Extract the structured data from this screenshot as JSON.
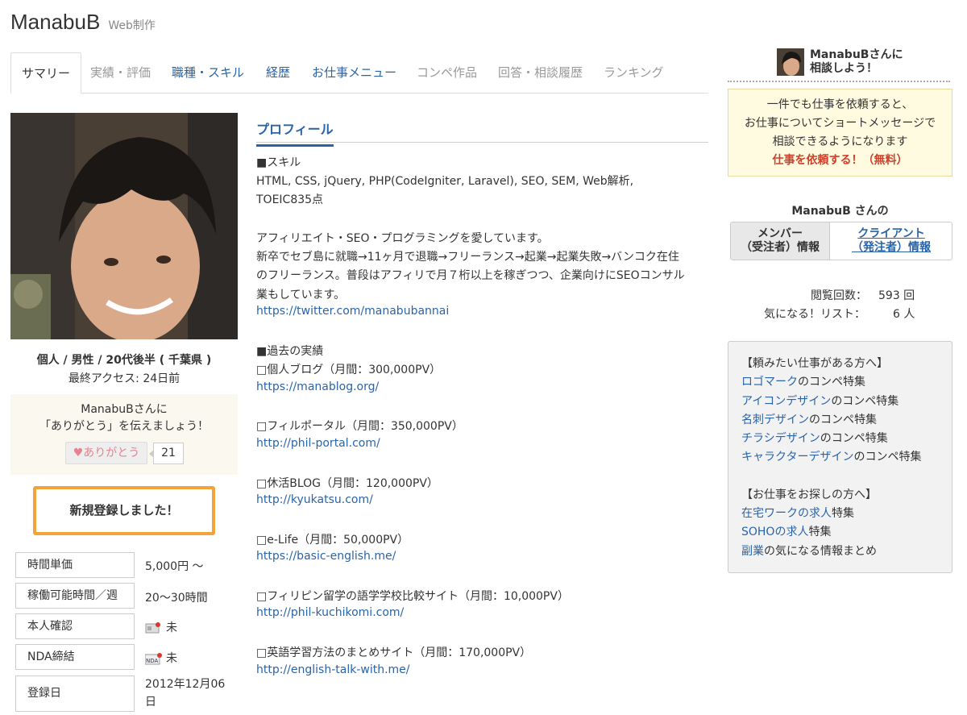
{
  "header": {
    "name": "ManabuB",
    "category": "Web制作"
  },
  "tabs": [
    {
      "label": "サマリー"
    },
    {
      "label": "実績・評価"
    },
    {
      "label": "職種・スキル"
    },
    {
      "label": "経歴"
    },
    {
      "label": "お仕事メニュー"
    },
    {
      "label": "コンペ作品"
    },
    {
      "label": "回答・相談履歴"
    },
    {
      "label": "ランキング"
    }
  ],
  "left": {
    "demographics": "個人 / 男性 / 20代後半 ( 千葉県 )",
    "last_access": "最終アクセス: 24日前",
    "thanks_line1": "ManabuBさんに",
    "thanks_line2": "「ありがとう」を伝えましょう！",
    "thanks_button": "ありがとう",
    "thanks_count": "21",
    "registered_banner": "新規登録しました！",
    "info": [
      {
        "label": "時間単価",
        "value": "5,000円 〜"
      },
      {
        "label": "稼働可能時間／週",
        "value": "20〜30時間"
      },
      {
        "label": "本人確認",
        "value": "未"
      },
      {
        "label": "NDA締結",
        "value": "未"
      },
      {
        "label": "登録日",
        "value": "2012年12月06日"
      }
    ],
    "nda_icon_text": "NDA"
  },
  "profile": {
    "section_title": "プロフィール",
    "lines": [
      "■スキル",
      "HTML, CSS, jQuery, PHP(CodeIgniter, Laravel), SEO, SEM, Web解析,",
      "TOEIC835点",
      "アフィリエイト・SEO・プログラミングを愛しています。",
      "新卒でセブ島に就職→11ヶ月で退職→フリーランス→起業→起業失敗→バンコク在住",
      "のフリーランス。普段はアフィリで月７桁以上を稼ぎつつ、企業向けにSEOコンサル",
      "業もしています。",
      "https://twitter.com/manabubannai",
      "■過去の実績",
      "□個人ブログ（月間：300,000PV）",
      "https://manablog.org/",
      "□フィルポータル（月間：350,000PV）",
      "http://phil-portal.com/",
      "□休活BLOG（月間：120,000PV）",
      "http://kyukatsu.com/",
      "□e-Life（月間：50,000PV）",
      "https://basic-english.me/",
      "□フィリピン留学の語学学校比較サイト（月間：10,000PV）",
      "http://phil-kuchikomi.com/",
      "□英語学習方法のまとめサイト（月間：170,000PV）",
      "http://english-talk-with.me/"
    ]
  },
  "sidebar": {
    "consult_line1": "ManabuBさんに",
    "consult_line2": "相談しよう！",
    "notice_line1": "一件でも仕事を依頼すると、",
    "notice_line2": "お仕事についてショートメッセージで",
    "notice_line3": "相談できるようになります",
    "request_link": "仕事を依頼する！（無料）",
    "whos": "ManabuB さんの",
    "member_tab_1": "メンバー",
    "member_tab_2": "（受注者）情報",
    "client_tab_1": "クライアント",
    "client_tab_2": "（発注者）情報",
    "views_label": "閲覧回数：",
    "views_value": "593 回",
    "fav_label": "気になる！リスト：",
    "fav_value": "6 人",
    "links_heading1": "【頼みたい仕事がある方へ】",
    "links1": [
      {
        "link": "ロゴマーク",
        "rest": "のコンペ特集"
      },
      {
        "link": "アイコンデザイン",
        "rest": "のコンペ特集"
      },
      {
        "link": "名刺デザイン",
        "rest": "のコンペ特集"
      },
      {
        "link": "チラシデザイン",
        "rest": "のコンペ特集"
      },
      {
        "link": "キャラクターデザイン",
        "rest": "のコンペ特集"
      }
    ],
    "links_heading2": "【お仕事をお探しの方へ】",
    "links2": [
      {
        "link": "在宅ワークの求人",
        "rest": "特集"
      },
      {
        "link": "SOHOの求人",
        "rest": "特集"
      },
      {
        "link": "副業",
        "rest": "の気になる情報まとめ"
      }
    ]
  },
  "colors": {
    "link": "#2a64a8",
    "accent_orange": "#f3a33b",
    "request_red": "#d0402a"
  }
}
